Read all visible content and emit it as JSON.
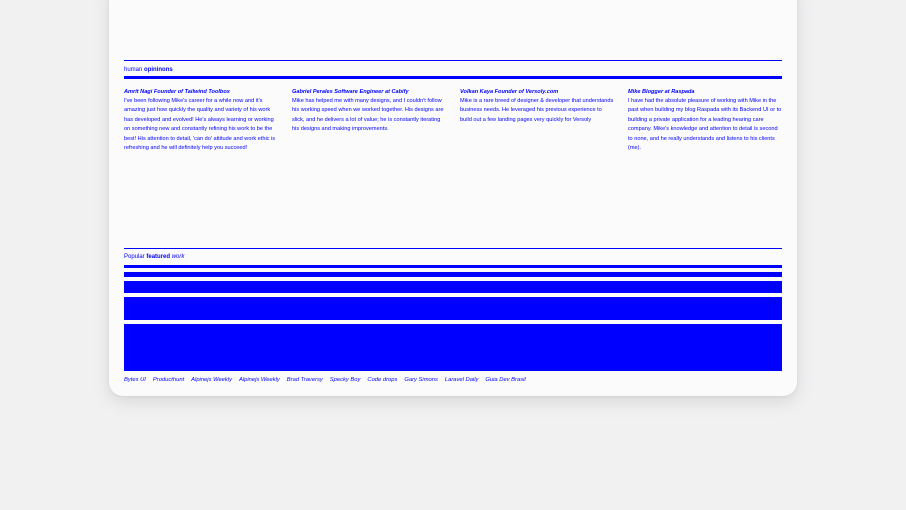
{
  "opinions": {
    "label_prefix": "human",
    "label_bold": "opininons",
    "testimonials": [
      {
        "name": "Amrit Nagi Founder of Tailwind Toolbox",
        "text": "I've been following Mike's career for a while now and it's amazing just how quickly the quality and variety of his work has developed and evolved! He's always learning or working on something new and constantly refining his work to be the best! His attention to detail, 'can do' attitude and work ethic is refreshing and he will definitely help you succeed!"
      },
      {
        "name": "Gabriel Perales Software Engineer at Cabify",
        "text": "Mike has helped me with many designs, and I couldn't follow his working speed when we worked together. His designs are slick, and he delivers a lot of value; he is constantly iterating his designs and making improvements."
      },
      {
        "name": "Volkan Kaya Founder of Versoly.com",
        "text": "Mike is a rare breed of designer & developer that understands business needs. He leveraged his previous experience to build out a few landing pages very quickly for Versoly"
      },
      {
        "name": "Mike Blogger at Raspada",
        "text": "I have had the absolute pleasure of working with Mike in the past when building my blog Raspada with its Backend UI or to building a private application for a leading hearing care company. Mike's knowledge and attention to detail is second to none, and he really understands and listens to his clients (me)."
      }
    ]
  },
  "featured": {
    "label_prefix": "Popular",
    "label_bold": "featured",
    "label_italic": "work",
    "links": [
      "Bytes UI",
      "Producthunt",
      "Alpinejs Weekly",
      "Alpinejs Weekly",
      "Brad Traversy",
      "Specky Boy",
      "Code drops",
      "Gary Simons",
      "Laravel Daily",
      "Guia Dev Brasil"
    ]
  },
  "colors": {
    "accent": "#0000ff",
    "card_background": "#fbfbfb",
    "page_background": "#f1f1f2"
  }
}
